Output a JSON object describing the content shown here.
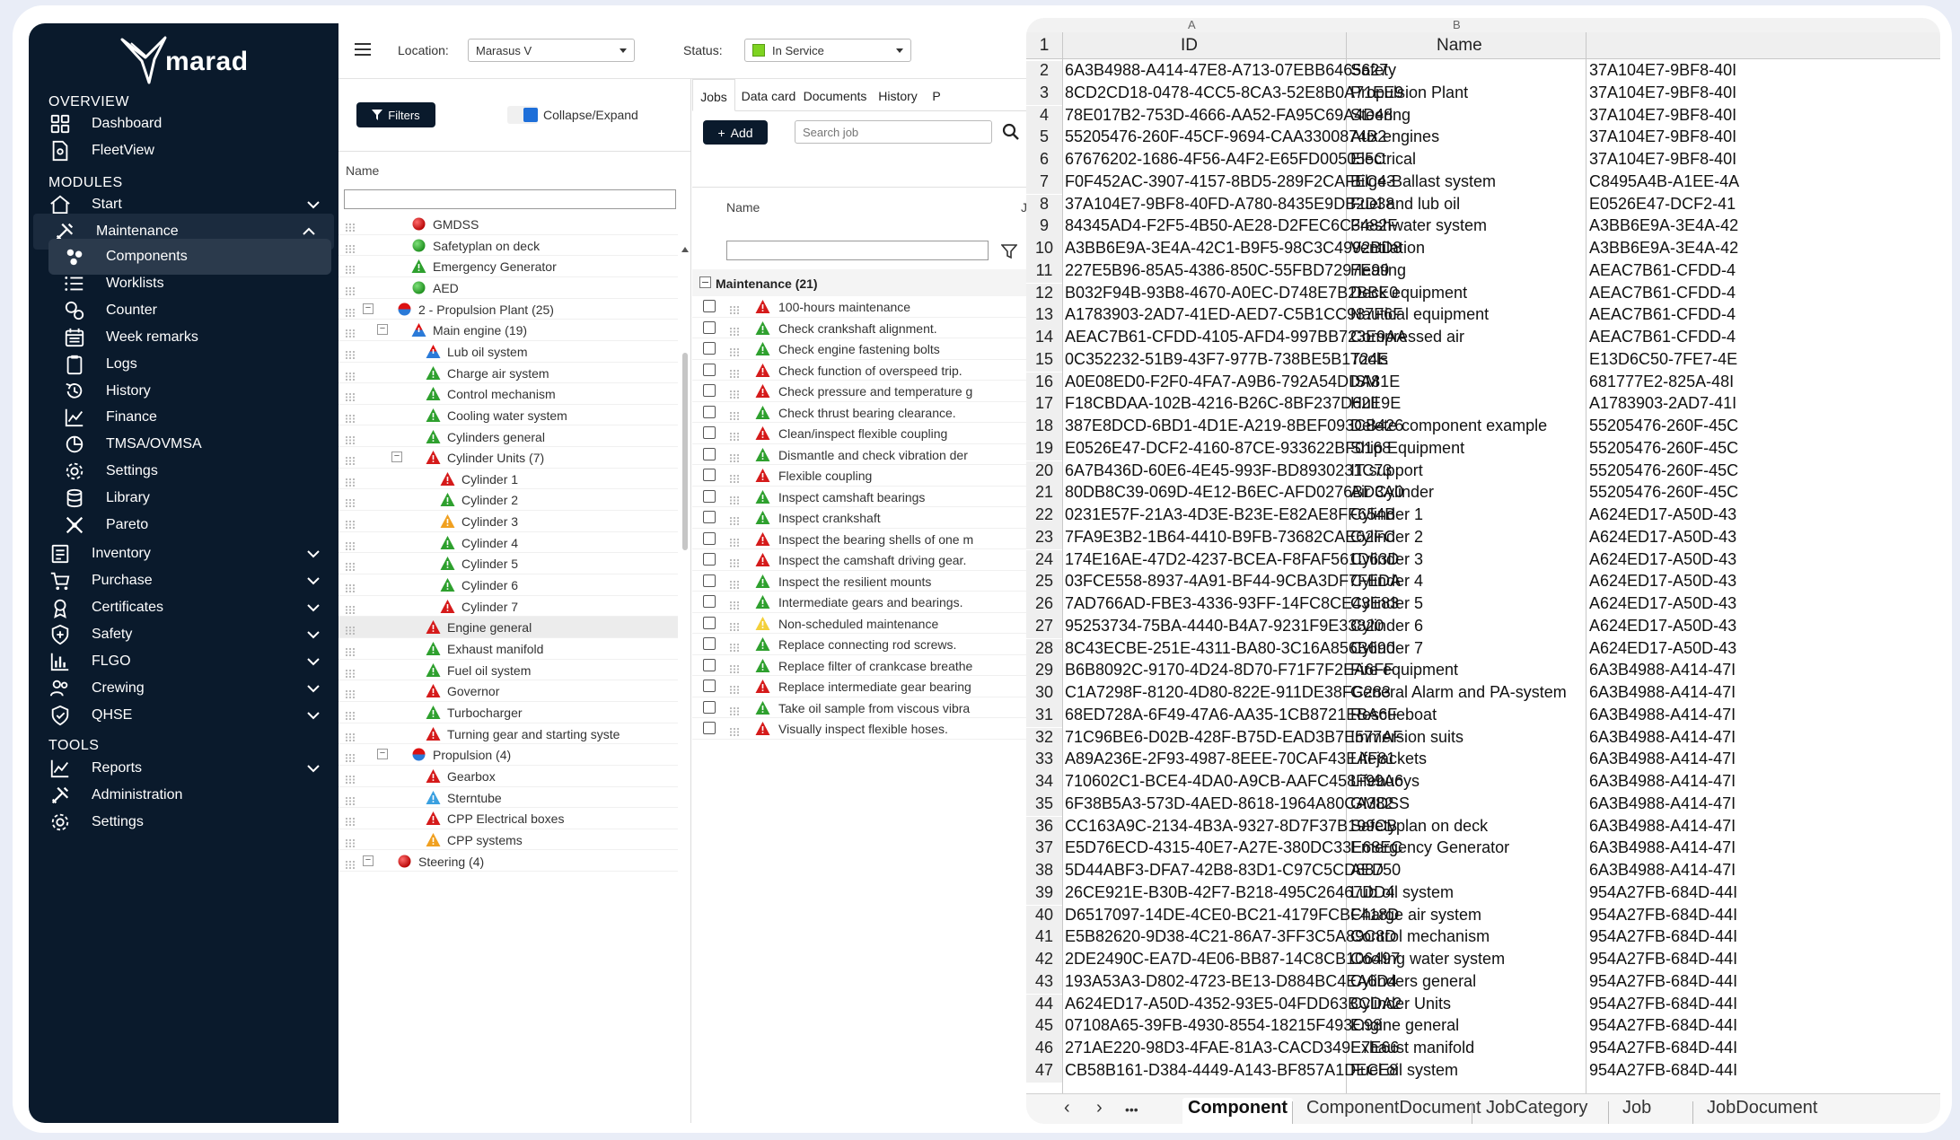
{
  "app": {
    "brand": "marad",
    "location_label": "Location:",
    "location_value": "Marasus V",
    "status_label": "Status:",
    "status_value": "In Service",
    "status_color": "#7ed321"
  },
  "sidebar": {
    "overview_header": "OVERVIEW",
    "overview": [
      {
        "label": "Dashboard",
        "icon": "grid-icon"
      },
      {
        "label": "FleetView",
        "icon": "fleet-icon"
      }
    ],
    "modules_header": "MODULES",
    "start": {
      "label": "Start",
      "icon": "home-icon"
    },
    "maintenance": {
      "label": "Maintenance",
      "icon": "tools-icon"
    },
    "maintenance_items": [
      {
        "label": "Components",
        "icon": "components-icon"
      },
      {
        "label": "Worklists",
        "icon": "list-icon"
      },
      {
        "label": "Counter",
        "icon": "counter-icon"
      },
      {
        "label": "Week remarks",
        "icon": "calendar-icon"
      },
      {
        "label": "Logs",
        "icon": "clipboard-icon"
      },
      {
        "label": "History",
        "icon": "history-icon"
      },
      {
        "label": "Finance",
        "icon": "chart-line-icon"
      },
      {
        "label": "TMSA/OVMSA",
        "icon": "pie-icon"
      },
      {
        "label": "Settings",
        "icon": "gear-icon"
      },
      {
        "label": "Library",
        "icon": "database-icon"
      },
      {
        "label": "Pareto",
        "icon": "pareto-icon"
      }
    ],
    "modules": [
      {
        "label": "Inventory",
        "icon": "inventory-icon"
      },
      {
        "label": "Purchase",
        "icon": "cart-icon"
      },
      {
        "label": "Certificates",
        "icon": "certificate-icon"
      },
      {
        "label": "Safety",
        "icon": "shield-plus-icon"
      },
      {
        "label": "FLGO",
        "icon": "bar-chart-icon"
      },
      {
        "label": "Crewing",
        "icon": "people-icon"
      },
      {
        "label": "QHSE",
        "icon": "shield-check-icon"
      }
    ],
    "tools_header": "TOOLS",
    "tools": [
      {
        "label": "Reports",
        "icon": "chart-line-icon"
      },
      {
        "label": "Administration",
        "icon": "tools-icon"
      },
      {
        "label": "Settings",
        "icon": "gear-icon"
      }
    ]
  },
  "tree": {
    "filters_label": "Filters",
    "collapse_label": "Collapse/Expand",
    "column_name": "Name",
    "rows": [
      {
        "label": "GMDSS",
        "level": 1,
        "status": "red-dot"
      },
      {
        "label": "Safetyplan on deck",
        "level": 1,
        "status": "green-dot"
      },
      {
        "label": "Emergency Generator",
        "level": 1,
        "status": "green-triangle"
      },
      {
        "label": "AED",
        "level": 1,
        "status": "green-dot"
      },
      {
        "label": "2 - Propulsion Plant (25)",
        "level": 0,
        "status": "mixed-dot",
        "expander": "−"
      },
      {
        "label": "Main engine (19)",
        "level": 1,
        "status": "mixed-triangle",
        "expander": "−"
      },
      {
        "label": "Lub oil system",
        "level": 2,
        "status": "mixed-triangle"
      },
      {
        "label": "Charge air system",
        "level": 2,
        "status": "green-triangle"
      },
      {
        "label": "Control mechanism",
        "level": 2,
        "status": "green-triangle"
      },
      {
        "label": "Cooling water system",
        "level": 2,
        "status": "green-triangle"
      },
      {
        "label": "Cylinders general",
        "level": 2,
        "status": "green-triangle"
      },
      {
        "label": "Cylinder Units (7)",
        "level": 2,
        "status": "red-triangle",
        "expander": "−"
      },
      {
        "label": "Cylinder 1",
        "level": 3,
        "status": "red-triangle"
      },
      {
        "label": "Cylinder 2",
        "level": 3,
        "status": "green-triangle"
      },
      {
        "label": "Cylinder 3",
        "level": 3,
        "status": "orange-triangle"
      },
      {
        "label": "Cylinder 4",
        "level": 3,
        "status": "green-triangle"
      },
      {
        "label": "Cylinder 5",
        "level": 3,
        "status": "green-triangle"
      },
      {
        "label": "Cylinder 6",
        "level": 3,
        "status": "green-triangle"
      },
      {
        "label": "Cylinder 7",
        "level": 3,
        "status": "red-triangle"
      },
      {
        "label": "Engine general",
        "level": 2,
        "status": "red-triangle",
        "selected": true
      },
      {
        "label": "Exhaust manifold",
        "level": 2,
        "status": "green-triangle"
      },
      {
        "label": "Fuel oil system",
        "level": 2,
        "status": "green-triangle"
      },
      {
        "label": "Governor",
        "level": 2,
        "status": "red-triangle"
      },
      {
        "label": "Turbocharger",
        "level": 2,
        "status": "green-triangle"
      },
      {
        "label": "Turning gear and starting syste",
        "level": 2,
        "status": "red-triangle"
      },
      {
        "label": "Propulsion (4)",
        "level": 1,
        "status": "mixed-dot",
        "expander": "−"
      },
      {
        "label": "Gearbox",
        "level": 2,
        "status": "red-triangle"
      },
      {
        "label": "Sterntube",
        "level": 2,
        "status": "blue-triangle"
      },
      {
        "label": "CPP Electrical boxes",
        "level": 2,
        "status": "red-triangle"
      },
      {
        "label": "CPP systems",
        "level": 2,
        "status": "orange-triangle"
      },
      {
        "label": "Steering (4)",
        "level": 0,
        "status": "red-dot",
        "expander": "−"
      }
    ]
  },
  "jobs": {
    "tabs": [
      "Jobs",
      "Data card",
      "Documents",
      "History",
      "P"
    ],
    "add_label": "Add",
    "search_placeholder": "Search job",
    "column_name": "Name",
    "column_next": "Jo",
    "group_label": "Maintenance (21)",
    "rows": [
      {
        "label": "100-hours maintenance",
        "status": "red"
      },
      {
        "label": "Check crankshaft alignment.",
        "status": "green"
      },
      {
        "label": "Check engine fastening bolts",
        "status": "green"
      },
      {
        "label": "Check function of overspeed trip.",
        "status": "red"
      },
      {
        "label": "Check pressure and temperature g",
        "status": "red"
      },
      {
        "label": "Check thrust bearing clearance.",
        "status": "green"
      },
      {
        "label": "Clean/inspect flexible coupling",
        "status": "red"
      },
      {
        "label": "Dismantle and check vibration der",
        "status": "green"
      },
      {
        "label": "Flexible coupling",
        "status": "red"
      },
      {
        "label": "Inspect camshaft bearings",
        "status": "green"
      },
      {
        "label": "Inspect crankshaft",
        "status": "green"
      },
      {
        "label": "Inspect the bearing shells of one m",
        "status": "red"
      },
      {
        "label": "Inspect the camshaft driving gear.",
        "status": "red"
      },
      {
        "label": "Inspect the resilient mounts",
        "status": "green"
      },
      {
        "label": "Intermediate gears and bearings.",
        "status": "green"
      },
      {
        "label": "Non-scheduled maintenance",
        "status": "yellow"
      },
      {
        "label": "Replace connecting rod screws.",
        "status": "green"
      },
      {
        "label": "Replace filter of crankcase breathe",
        "status": "green"
      },
      {
        "label": "Replace intermediate gear bearing",
        "status": "red"
      },
      {
        "label": "Take oil sample from viscous vibra",
        "status": "green"
      },
      {
        "label": "Visually inspect flexible hoses.",
        "status": "red"
      }
    ]
  },
  "sheet": {
    "col_letters": [
      "A",
      "B"
    ],
    "header": {
      "num": "1",
      "id": "ID",
      "name": "Name"
    },
    "rows": [
      {
        "n": "2",
        "id": "6A3B4988-A414-47E8-A713-07EBB6465627",
        "name": "Safety",
        "parent": "37A104E7-9BF8-40I"
      },
      {
        "n": "3",
        "id": "8CD2CD18-0478-4CC5-8CA3-52E8B0A71EE9",
        "name": "Propulsion Plant",
        "parent": "37A104E7-9BF8-40I"
      },
      {
        "n": "4",
        "id": "78E017B2-753D-4666-AA52-FA95C69A4D48",
        "name": "Steering",
        "parent": "37A104E7-9BF8-40I"
      },
      {
        "n": "5",
        "id": "55205476-260F-45CF-9694-CAA3300874B2",
        "name": "Aux engines",
        "parent": "37A104E7-9BF8-40I"
      },
      {
        "n": "6",
        "id": "67676202-1686-4F56-A4F2-E65FD005055C",
        "name": "Electrical",
        "parent": "37A104E7-9BF8-40I"
      },
      {
        "n": "7",
        "id": "F0F452AC-3907-4157-8BD5-289F2CAFEC43",
        "name": "Bilge-Ballast system",
        "parent": "C8495A4B-A1EE-4A"
      },
      {
        "n": "8",
        "id": "37A104E7-9BF8-40FD-A780-8435E9DB2D38",
        "name": "Fuel and lub oil",
        "parent": "E0526E47-DCF2-41"
      },
      {
        "n": "9",
        "id": "84345AD4-F2F5-4B50-AE28-D2FEC6C3482F",
        "name": "Freshwater system",
        "parent": "A3BB6E9A-3E4A-42"
      },
      {
        "n": "10",
        "id": "A3BB6E9A-3E4A-42C1-B9F5-98C3C4992BD8",
        "name": "Ventilation",
        "parent": "A3BB6E9A-3E4A-42"
      },
      {
        "n": "11",
        "id": "227E5B96-85A5-4386-850C-55FBD7297E99",
        "name": "Heating",
        "parent": "AEAC7B61-CFDD-4"
      },
      {
        "n": "12",
        "id": "B032F94B-93B8-4670-A0EC-D748E7B2BBE0",
        "name": "Deck equipment",
        "parent": "AEAC7B61-CFDD-4"
      },
      {
        "n": "13",
        "id": "A1783903-2AD7-41ED-AED7-C5B1CC987F6F",
        "name": "Nautical equipment",
        "parent": "AEAC7B61-CFDD-4"
      },
      {
        "n": "14",
        "id": "AEAC7B61-CFDD-4105-AFD4-997BB723E9AA",
        "name": "Compressed air",
        "parent": "AEAC7B61-CFDD-4"
      },
      {
        "n": "15",
        "id": "0C352232-51B9-43F7-977B-738BE5B1724E",
        "name": "Tools",
        "parent": "E13D6C50-7FE7-4E"
      },
      {
        "n": "16",
        "id": "A0E08ED0-F2F0-4FA7-A9B6-792A54DDA81E",
        "name": "ISM",
        "parent": "681777E2-825A-48I"
      },
      {
        "n": "17",
        "id": "F18CBDAA-102B-4216-B26C-8BF237D62E9E",
        "name": "Hull",
        "parent": "A1783903-2AD7-41I"
      },
      {
        "n": "18",
        "id": "387E8DCD-6BD1-4D1E-A219-8BEF093CB426",
        "name": "Delete component example",
        "parent": "55205476-260F-45C"
      },
      {
        "n": "19",
        "id": "E0526E47-DCF2-4160-87CE-933622BF0168",
        "name": "Ship Equipment",
        "parent": "55205476-260F-45C"
      },
      {
        "n": "20",
        "id": "6A7B436D-60E6-4E45-993F-BD8930231C73",
        "name": "IT support",
        "parent": "55205476-260F-45C"
      },
      {
        "n": "21",
        "id": "80DB8C39-069D-4E12-B6EC-AFD0276BD3A0",
        "name": "Air Cylinder",
        "parent": "55205476-260F-45C"
      },
      {
        "n": "22",
        "id": "0231E57F-21A3-4D3E-B23E-E82AE8FF654B",
        "name": "Cylinder 1",
        "parent": "A624ED17-A50D-43"
      },
      {
        "n": "23",
        "id": "7FA9E3B2-1B64-4410-B9FB-73682CAE62FC",
        "name": "Cylinder 2",
        "parent": "A624ED17-A50D-43"
      },
      {
        "n": "24",
        "id": "174E16AE-47D2-4237-BCEA-F8FAF561D63D",
        "name": "Cylinder 3",
        "parent": "A624ED17-A50D-43"
      },
      {
        "n": "25",
        "id": "03FCE558-8937-4A91-BF44-9CBA3DF7FEDA",
        "name": "Cylinder 4",
        "parent": "A624ED17-A50D-43"
      },
      {
        "n": "26",
        "id": "7AD766AD-FBE3-4336-93FF-14FC8CE43E83",
        "name": "Cylinder 5",
        "parent": "A624ED17-A50D-43"
      },
      {
        "n": "27",
        "id": "95253734-75BA-4440-B4A7-9231F9E33820",
        "name": "Cylinder 6",
        "parent": "A624ED17-A50D-43"
      },
      {
        "n": "28",
        "id": "8C43ECBE-251E-4311-BA80-3C16A856B690",
        "name": "Cylinder 7",
        "parent": "A624ED17-A50D-43"
      },
      {
        "n": "29",
        "id": "B6B8092C-9170-4D24-8D70-F71F7F2EA6FF",
        "name": "Fire equipment",
        "parent": "6A3B4988-A414-47I"
      },
      {
        "n": "30",
        "id": "C1A7298F-8120-4D80-822E-911DE38FC283",
        "name": "General Alarm and PA-system",
        "parent": "6A3B4988-A414-47I"
      },
      {
        "n": "31",
        "id": "68ED728A-6F49-47A6-AA35-1CB8721EBA6F",
        "name": "Rescueboat",
        "parent": "6A3B4988-A414-47I"
      },
      {
        "n": "32",
        "id": "71C96BE6-D02B-428F-B75D-EAD3B7E577AF",
        "name": "Immersion suits",
        "parent": "6A3B4988-A414-47I"
      },
      {
        "n": "33",
        "id": "A89A236E-2F93-4987-8EEE-70CAF43EAF81",
        "name": "Lifejackets",
        "parent": "6A3B4988-A414-47I"
      },
      {
        "n": "34",
        "id": "710602C1-BCE4-4DA0-A9CB-AAFC458F99A6",
        "name": "Lifebuoys",
        "parent": "6A3B4988-A414-47I"
      },
      {
        "n": "35",
        "id": "6F38B5A3-573D-4AED-8618-1964A80CA382",
        "name": "GMDSS",
        "parent": "6A3B4988-A414-47I"
      },
      {
        "n": "36",
        "id": "CC163A9C-2134-4B3A-9327-8D7F37B199CB",
        "name": "Safetyplan on deck",
        "parent": "6A3B4988-A414-47I"
      },
      {
        "n": "37",
        "id": "E5D76ECD-4315-40E7-A27E-380DC33E68EC",
        "name": "Emergency Generator",
        "parent": "6A3B4988-A414-47I"
      },
      {
        "n": "38",
        "id": "5D44ABF3-DFA7-42B8-83D1-C97C5CD88750",
        "name": "AED",
        "parent": "6A3B4988-A414-47I"
      },
      {
        "n": "39",
        "id": "26CE921E-B30B-42F7-B218-495C26467DD4",
        "name": "Lub oil system",
        "parent": "954A27FB-684D-44I"
      },
      {
        "n": "40",
        "id": "D6517097-14DE-4CE0-BC21-4179FCBF418D",
        "name": "Charge air system",
        "parent": "954A27FB-684D-44I"
      },
      {
        "n": "41",
        "id": "E5B82620-9D38-4C21-86A7-3FF3C5A89C8D",
        "name": "Control mechanism",
        "parent": "954A27FB-684D-44I"
      },
      {
        "n": "42",
        "id": "2DE2490C-EA7D-4E06-BB87-14C8CB106497",
        "name": "Cooling water system",
        "parent": "954A27FB-684D-44I"
      },
      {
        "n": "43",
        "id": "193A53A3-D802-4723-BE13-D884BC4EA6D4",
        "name": "Cylinders general",
        "parent": "954A27FB-684D-44I"
      },
      {
        "n": "44",
        "id": "A624ED17-A50D-4352-93E5-04FDD63BCDA2",
        "name": "Cylinder Units",
        "parent": "954A27FB-684D-44I"
      },
      {
        "n": "45",
        "id": "07108A65-39FB-4930-8554-18215F493C98",
        "name": "Engine general",
        "parent": "954A27FB-684D-44I"
      },
      {
        "n": "46",
        "id": "271AE220-98D3-4FAE-81A3-CACD349E7E66",
        "name": "Exhaust manifold",
        "parent": "954A27FB-684D-44I"
      },
      {
        "n": "47",
        "id": "CB58B161-D384-4449-A143-BF857A1DECE8",
        "name": "Fuel oil system",
        "parent": "954A27FB-684D-44I"
      }
    ],
    "tabs": [
      "Component",
      "ComponentDocument",
      "JobCategory",
      "Job",
      "JobDocument"
    ],
    "nav_prev": "‹",
    "nav_next": "›",
    "nav_more": "•••"
  }
}
